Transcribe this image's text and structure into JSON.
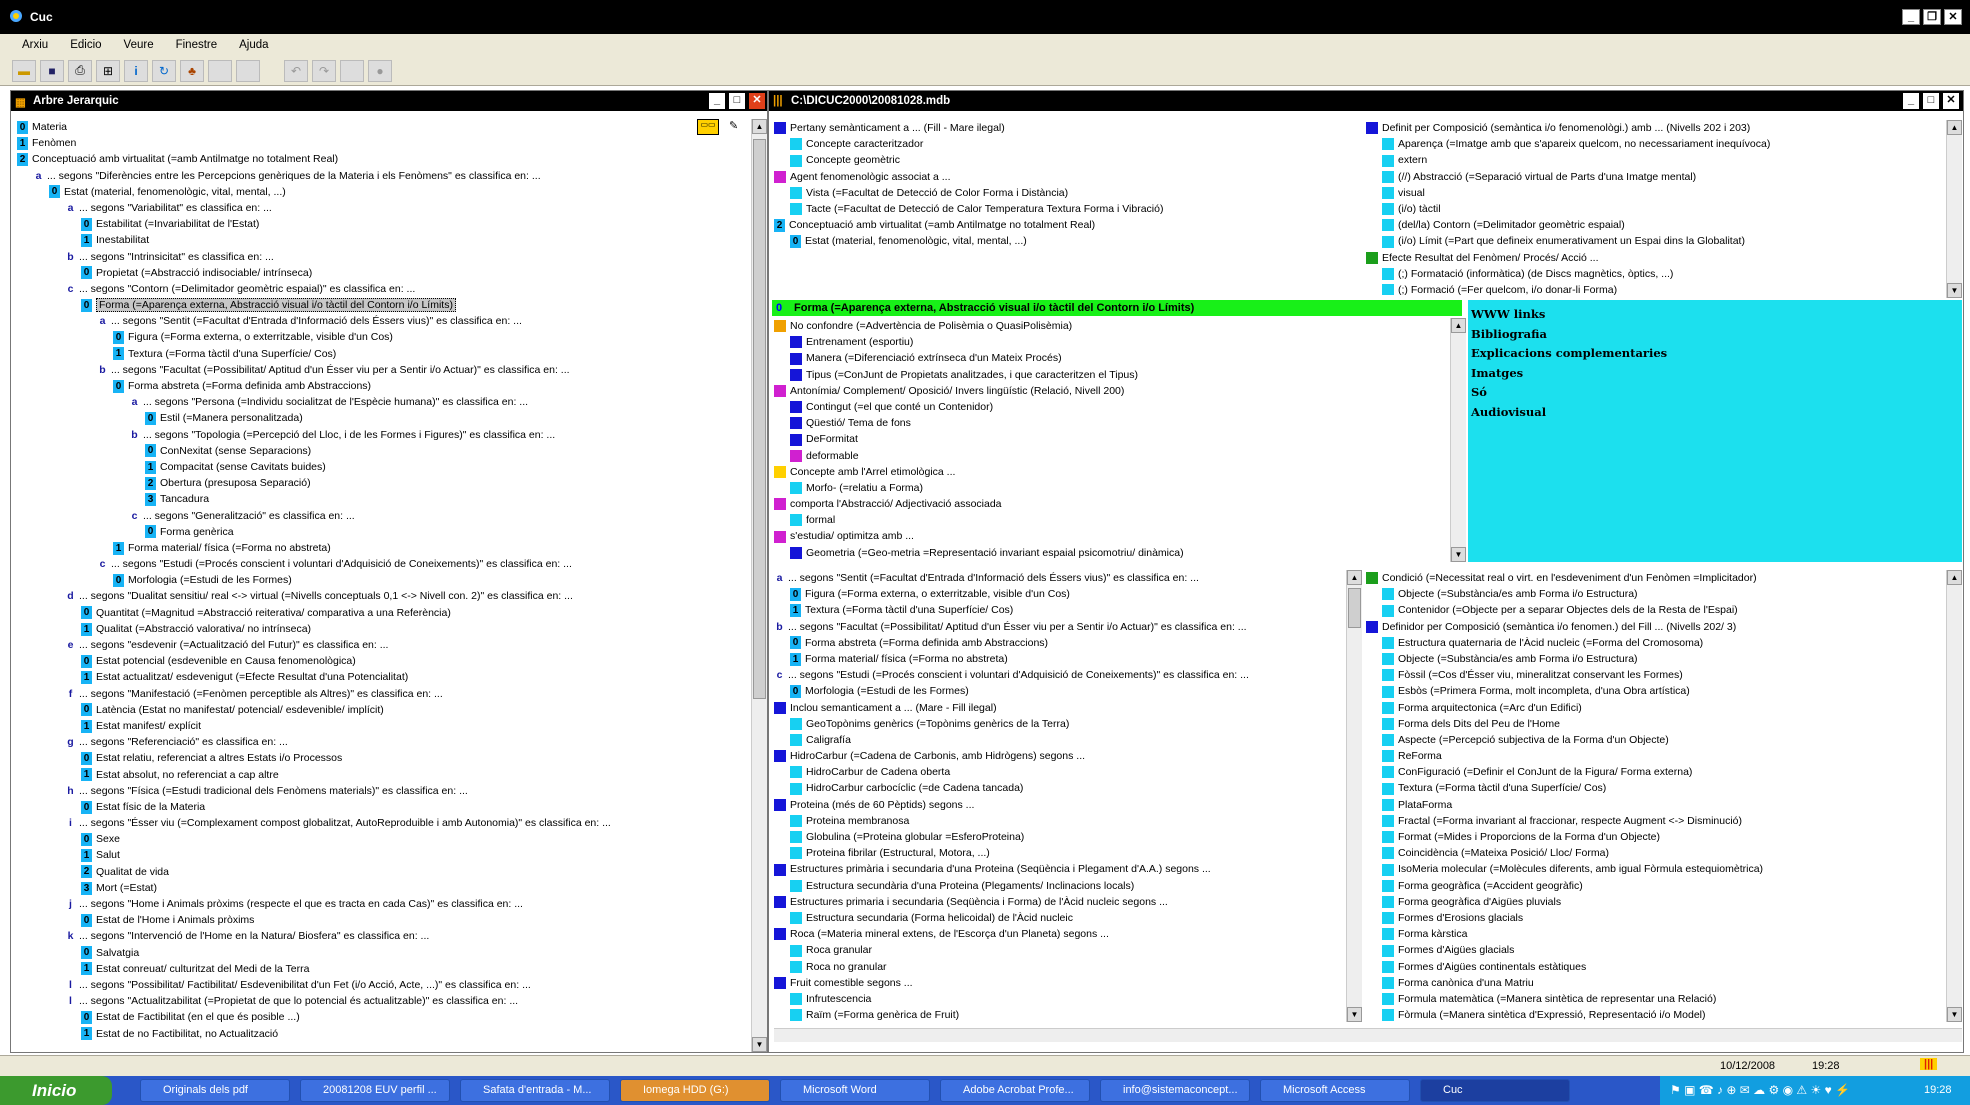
{
  "app": {
    "title": "Cuc",
    "menu": [
      "Arxiu",
      "Edicio",
      "Veure",
      "Finestre",
      "Ajuda"
    ]
  },
  "tree_panel": {
    "title": "Arbre Jerarquic",
    "rows": [
      {
        "i": 0,
        "t": "n",
        "m": "0",
        "x": "Materia"
      },
      {
        "i": 0,
        "t": "n",
        "m": "1",
        "x": "Fenòmen"
      },
      {
        "i": 0,
        "t": "n",
        "m": "2",
        "x": "Conceptuació amb virtualitat (=amb Antilmatge no totalment Real)"
      },
      {
        "i": 1,
        "t": "l",
        "m": "a",
        "x": "... segons \"Diferències entre les Percepcions genèriques de la Materia i els Fenòmens\" es classifica en: ..."
      },
      {
        "i": 2,
        "t": "n",
        "m": "0",
        "x": "Estat (material, fenomenològic, vital, mental, ...)"
      },
      {
        "i": 3,
        "t": "l",
        "m": "a",
        "x": "... segons \"Variabilitat\" es classifica en: ..."
      },
      {
        "i": 4,
        "t": "n",
        "m": "0",
        "x": "Estabilitat (=Invariabilitat de l'Estat)"
      },
      {
        "i": 4,
        "t": "n",
        "m": "1",
        "x": "Inestabilitat"
      },
      {
        "i": 3,
        "t": "l",
        "m": "b",
        "x": "... segons \"Intrinsicitat\" es classifica en: ..."
      },
      {
        "i": 4,
        "t": "n",
        "m": "0",
        "x": "Propietat (=Abstracció indisociable/ intrínseca)"
      },
      {
        "i": 3,
        "t": "l",
        "m": "c",
        "x": "... segons \"Contorn (=Delimitador geomètric espaial)\" es classifica en: ..."
      },
      {
        "i": 4,
        "t": "s",
        "m": "0",
        "x": "Forma (=Aparença externa, Abstracció visual i/o tàctil del Contorn i/o Límits)"
      },
      {
        "i": 5,
        "t": "l",
        "m": "a",
        "x": "... segons \"Sentit (=Facultat d'Entrada d'Informació dels Éssers vius)\" es classifica en: ..."
      },
      {
        "i": 6,
        "t": "n",
        "m": "0",
        "x": "Figura (=Forma externa, o exterritzable, visible d'un Cos)"
      },
      {
        "i": 6,
        "t": "n",
        "m": "1",
        "x": "Textura (=Forma tàctil d'una Superfície/ Cos)"
      },
      {
        "i": 5,
        "t": "l",
        "m": "b",
        "x": "... segons \"Facultat (=Possibilitat/ Aptitud d'un Ésser viu per a Sentir i/o Actuar)\" es classifica en: ..."
      },
      {
        "i": 6,
        "t": "n",
        "m": "0",
        "x": "Forma abstreta (=Forma definida amb Abstraccions)"
      },
      {
        "i": 7,
        "t": "l",
        "m": "a",
        "x": "... segons \"Persona (=Individu socialitzat de l'Espècie humana)\" es classifica en: ..."
      },
      {
        "i": 8,
        "t": "n",
        "m": "0",
        "x": "Estil (=Manera personalitzada)"
      },
      {
        "i": 7,
        "t": "l",
        "m": "b",
        "x": "... segons \"Topologia (=Percepció del Lloc, i de les Formes i Figures)\" es classifica en: ..."
      },
      {
        "i": 8,
        "t": "n",
        "m": "0",
        "x": "ConNexitat (sense Separacions)"
      },
      {
        "i": 8,
        "t": "n",
        "m": "1",
        "x": "Compacitat (sense Cavitats buides)"
      },
      {
        "i": 8,
        "t": "n",
        "m": "2",
        "x": "Obertura (presuposa Separació)"
      },
      {
        "i": 8,
        "t": "n",
        "m": "3",
        "x": "Tancadura"
      },
      {
        "i": 7,
        "t": "l",
        "m": "c",
        "x": "... segons \"Generalització\" es classifica en: ..."
      },
      {
        "i": 8,
        "t": "n",
        "m": "0",
        "x": "Forma genèrica"
      },
      {
        "i": 6,
        "t": "n",
        "m": "1",
        "x": "Forma material/ física (=Forma no abstreta)"
      },
      {
        "i": 5,
        "t": "l",
        "m": "c",
        "x": "... segons \"Estudi (=Procés conscient i voluntari d'Adquisició de Coneixements)\" es classifica en: ..."
      },
      {
        "i": 6,
        "t": "n",
        "m": "0",
        "x": "Morfologia (=Estudi de les Formes)"
      },
      {
        "i": 3,
        "t": "l",
        "m": "d",
        "x": "... segons \"Dualitat sensitiu/ real <-> virtual (=Nivells conceptuals 0,1 <-> Nivell con. 2)\" es classifica en: ..."
      },
      {
        "i": 4,
        "t": "n",
        "m": "0",
        "x": "Quantitat (=Magnitud =Abstracció reiterativa/ comparativa a una Referència)"
      },
      {
        "i": 4,
        "t": "n",
        "m": "1",
        "x": "Qualitat (=Abstracció valorativa/ no intrínseca)"
      },
      {
        "i": 3,
        "t": "l",
        "m": "e",
        "x": "... segons \"esdevenir (=Actualització del Futur)\" es classifica en: ..."
      },
      {
        "i": 4,
        "t": "n",
        "m": "0",
        "x": "Estat potencial (esdevenible en Causa fenomenològica)"
      },
      {
        "i": 4,
        "t": "n",
        "m": "1",
        "x": "Estat actualitzat/ esdevenigut (=Efecte Resultat d'una Potencialitat)"
      },
      {
        "i": 3,
        "t": "l",
        "m": "f",
        "x": "... segons \"Manifestació (=Fenòmen perceptible als Altres)\" es classifica en: ..."
      },
      {
        "i": 4,
        "t": "n",
        "m": "0",
        "x": "Latència (Estat no manifestat/ potencial/ esdevenible/ implícit)"
      },
      {
        "i": 4,
        "t": "n",
        "m": "1",
        "x": "Estat manifest/ explícit"
      },
      {
        "i": 3,
        "t": "l",
        "m": "g",
        "x": "... segons \"Referenciació\" es classifica en: ..."
      },
      {
        "i": 4,
        "t": "n",
        "m": "0",
        "x": "Estat relatiu, referenciat a altres Estats i/o Processos"
      },
      {
        "i": 4,
        "t": "n",
        "m": "1",
        "x": "Estat absolut, no referenciat a cap altre"
      },
      {
        "i": 3,
        "t": "l",
        "m": "h",
        "x": "... segons \"Física (=Estudi tradicional dels Fenòmens materials)\" es classifica en: ..."
      },
      {
        "i": 4,
        "t": "n",
        "m": "0",
        "x": "Estat físic de la Materia"
      },
      {
        "i": 3,
        "t": "l",
        "m": "i",
        "x": "... segons \"Ésser viu (=Complexament compost globalitzat, AutoReproduible i amb Autonomia)\" es classifica en: ..."
      },
      {
        "i": 4,
        "t": "n",
        "m": "0",
        "x": "Sexe"
      },
      {
        "i": 4,
        "t": "n",
        "m": "1",
        "x": "Salut"
      },
      {
        "i": 4,
        "t": "n",
        "m": "2",
        "x": "Qualitat de vida"
      },
      {
        "i": 4,
        "t": "n",
        "m": "3",
        "x": "Mort (=Estat)"
      },
      {
        "i": 3,
        "t": "l",
        "m": "j",
        "x": "... segons \"Home i Animals pròxims (respecte el que es tracta en cada Cas)\" es classifica en: ..."
      },
      {
        "i": 4,
        "t": "n",
        "m": "0",
        "x": "Estat de l'Home i Animals pròxims"
      },
      {
        "i": 3,
        "t": "l",
        "m": "k",
        "x": "... segons \"Intervenció de l'Home en la Natura/ Biosfera\" es classifica en: ..."
      },
      {
        "i": 4,
        "t": "n",
        "m": "0",
        "x": "Salvatgia"
      },
      {
        "i": 4,
        "t": "n",
        "m": "1",
        "x": "Estat conreuat/ culturitzat del Medi de la Terra"
      },
      {
        "i": 3,
        "t": "l",
        "m": "l",
        "x": "... segons \"Possibilitat/ Factibilitat/ Esdevenibilitat d'un Fet (i/o Acció, Acte, ...)\" es classifica en: ..."
      },
      {
        "i": 3,
        "t": "l",
        "m": "l",
        "x": "... segons \"Actualitzabilitat (=Propietat de que lo potencial és actualitzable)\" es classifica en: ..."
      },
      {
        "i": 4,
        "t": "n",
        "m": "0",
        "x": "Estat de Factibilitat (en el que és posible ...)"
      },
      {
        "i": 4,
        "t": "n",
        "m": "1",
        "x": "Estat de no Factibilitat, no Actualització"
      }
    ]
  },
  "db_panel": {
    "title": "C:\\DICUC2000\\20081028.mdb",
    "top_left": [
      {
        "c": "blue",
        "i": 0,
        "x": "Pertany semànticament a ... (Fill - Mare ilegal)"
      },
      {
        "c": "cyan",
        "i": 1,
        "x": "Concepte caracteritzador"
      },
      {
        "c": "cyan",
        "i": 1,
        "x": "Concepte geomètric"
      },
      {
        "c": "mag",
        "i": 0,
        "x": "Agent fenomenològic associat a ..."
      },
      {
        "c": "cyan",
        "i": 1,
        "x": "Vista (=Facultat de Detecció de Color Forma i Distància)"
      },
      {
        "c": "cyan",
        "i": 1,
        "x": "Tacte (=Facultat de Detecció de Calor Temperatura Textura Forma i Vibració)"
      },
      {
        "c": "num",
        "m": "2",
        "i": 0,
        "x": "Conceptuació amb virtualitat (=amb Antilmatge no totalment Real)"
      },
      {
        "c": "num",
        "m": "0",
        "i": 1,
        "x": "Estat (material, fenomenològic, vital, mental, ...)"
      }
    ],
    "top_right": [
      {
        "c": "blue",
        "i": 0,
        "x": "Definit per Composició (semàntica i/o fenomenològi.) amb ... (Nivells 202 i 203)"
      },
      {
        "c": "cyan",
        "i": 1,
        "x": "Aparença (=Imatge amb que s'apareix quelcom, no necessariament inequívoca)"
      },
      {
        "c": "cyan",
        "i": 1,
        "x": "extern"
      },
      {
        "c": "cyan",
        "i": 1,
        "x": "(//) Abstracció (=Separació virtual de Parts d'una Imatge mental)"
      },
      {
        "c": "cyan",
        "i": 1,
        "x": "visual"
      },
      {
        "c": "cyan",
        "i": 1,
        "x": "(i/o) tàctil"
      },
      {
        "c": "cyan",
        "i": 1,
        "x": "(del/la) Contorn (=Delimitador geomètric espaial)"
      },
      {
        "c": "cyan",
        "i": 1,
        "x": "(i/o) Límit (=Part que defineix enumerativament un Espai dins la Globalitat)"
      },
      {
        "c": "grn",
        "i": 0,
        "x": "Efecte Resultat del Fenòmen/ Procés/ Acció ..."
      },
      {
        "c": "cyan",
        "i": 1,
        "x": "(;) Formatació (informàtica) (de Discs magnètics, òptics, ...)"
      },
      {
        "c": "cyan",
        "i": 1,
        "x": "(;) Formació (=Fer quelcom, i/o donar-li Forma)"
      }
    ],
    "selected": "Forma (=Aparença externa, Abstracció visual i/o tàctil del Contorn i/o Límits)",
    "mid_left": [
      {
        "c": "orng",
        "i": 0,
        "x": "No confondre (=Advertència de Polisèmia o QuasiPolisèmia)"
      },
      {
        "c": "blue",
        "i": 1,
        "x": "Entrenament (esportiu)"
      },
      {
        "c": "blue",
        "i": 1,
        "x": "Manera (=Diferenciació extrínseca d'un Mateix Procés)"
      },
      {
        "c": "blue",
        "i": 1,
        "x": "Tipus (=ConJunt de Propietats analitzades, i que caracteritzen el Tipus)"
      },
      {
        "c": "mag",
        "i": 0,
        "x": "Antonímia/ Complement/ Oposició/ Invers lingüístic (Relació, Nivell 200)"
      },
      {
        "c": "blue",
        "i": 1,
        "x": "Contingut (=el que conté un Contenidor)"
      },
      {
        "c": "blue",
        "i": 1,
        "x": "Qüestió/ Tema de fons"
      },
      {
        "c": "blue",
        "i": 1,
        "x": "DeFormitat"
      },
      {
        "c": "mag",
        "i": 1,
        "x": "deformable"
      },
      {
        "c": "yel",
        "i": 0,
        "x": "Concepte amb l'Arrel etimològica ..."
      },
      {
        "c": "cyan",
        "i": 1,
        "x": "Morfo- (=relatiu a Forma)"
      },
      {
        "c": "mag",
        "i": 0,
        "x": "comporta l'Abstracció/ Adjectivació associada"
      },
      {
        "c": "cyan",
        "i": 1,
        "x": "formal"
      },
      {
        "c": "mag",
        "i": 0,
        "x": "s'estudia/ optimitza amb ..."
      },
      {
        "c": "blue",
        "i": 1,
        "x": "Geometria (=Geo-metria =Representació invariant espaial psicomotriu/ dinàmica)"
      }
    ],
    "links": [
      "WWW links",
      "Bibliografia",
      "Explicacions complementaries",
      "Imatges",
      "Só",
      "Audiovisual"
    ],
    "bot_left": [
      {
        "c": "let",
        "m": "a",
        "i": 0,
        "x": "... segons \"Sentit (=Facultat d'Entrada d'Informació dels Éssers vius)\" es classifica en: ..."
      },
      {
        "c": "num",
        "m": "0",
        "i": 1,
        "x": "Figura (=Forma externa, o exterritzable, visible d'un Cos)"
      },
      {
        "c": "num",
        "m": "1",
        "i": 1,
        "x": "Textura (=Forma tàctil d'una Superfície/ Cos)"
      },
      {
        "c": "let",
        "m": "b",
        "i": 0,
        "x": "... segons \"Facultat (=Possibilitat/ Aptitud d'un Ésser viu per a Sentir i/o Actuar)\" es classifica en: ..."
      },
      {
        "c": "num",
        "m": "0",
        "i": 1,
        "x": "Forma abstreta (=Forma definida amb Abstraccions)"
      },
      {
        "c": "num",
        "m": "1",
        "i": 1,
        "x": "Forma material/ física (=Forma no abstreta)"
      },
      {
        "c": "let",
        "m": "c",
        "i": 0,
        "x": "... segons \"Estudi (=Procés conscient i voluntari d'Adquisició de Coneixements)\" es classifica en: ..."
      },
      {
        "c": "num",
        "m": "0",
        "i": 1,
        "x": "Morfologia (=Estudi de les Formes)"
      },
      {
        "c": "blue",
        "i": 0,
        "x": "Inclou semanticament a ... (Mare - Fill ilegal)"
      },
      {
        "c": "cyan",
        "i": 1,
        "x": "GeoTopònims genèrics (=Topònims genèrics de la Terra)"
      },
      {
        "c": "cyan",
        "i": 1,
        "x": "Caligrafía"
      },
      {
        "c": "blue",
        "i": 0,
        "x": "HidroCarbur (=Cadena de Carbonis, amb Hidrògens) segons ..."
      },
      {
        "c": "cyan",
        "i": 1,
        "x": "HidroCarbur de Cadena oberta"
      },
      {
        "c": "cyan",
        "i": 1,
        "x": "HidroCarbur carbocíclic (=de Cadena tancada)"
      },
      {
        "c": "blue",
        "i": 0,
        "x": "Proteina (més de 60 Pèptids) segons ..."
      },
      {
        "c": "cyan",
        "i": 1,
        "x": "Proteina membranosa"
      },
      {
        "c": "cyan",
        "i": 1,
        "x": "Globulina (=Proteina globular =EsferoProteina)"
      },
      {
        "c": "cyan",
        "i": 1,
        "x": "Proteina fibrilar (Estructural, Motora, ...)"
      },
      {
        "c": "blue",
        "i": 0,
        "x": "Estructures primària i secundaria d'una Proteina (Seqüència i Plegament d'A.A.) segons ..."
      },
      {
        "c": "cyan",
        "i": 1,
        "x": "Estructura secundària d'una Proteina (Plegaments/ Inclinacions locals)"
      },
      {
        "c": "blue",
        "i": 0,
        "x": "Estructures primaria i secundaria (Seqüència i Forma) de l'Àcid nucleic segons ..."
      },
      {
        "c": "cyan",
        "i": 1,
        "x": "Estructura secundaria (Forma helicoidal) de l'Àcid nucleic"
      },
      {
        "c": "blue",
        "i": 0,
        "x": "Roca (=Materia mineral extens, de l'Escorça d'un Planeta) segons ..."
      },
      {
        "c": "cyan",
        "i": 1,
        "x": "Roca granular"
      },
      {
        "c": "cyan",
        "i": 1,
        "x": "Roca no granular"
      },
      {
        "c": "blue",
        "i": 0,
        "x": "Fruit comestible segons ..."
      },
      {
        "c": "cyan",
        "i": 1,
        "x": "Infrutescencia"
      },
      {
        "c": "cyan",
        "i": 1,
        "x": "Raïm (=Forma genèrica de Fruit)"
      }
    ],
    "bot_right": [
      {
        "c": "grn",
        "i": 0,
        "x": "Condició (=Necessitat real o virt. en l'esdeveniment d'un Fenòmen =Implicitador)"
      },
      {
        "c": "cyan",
        "i": 1,
        "x": "Objecte (=Substància/es amb Forma i/o Estructura)"
      },
      {
        "c": "cyan",
        "i": 1,
        "x": "Contenidor (=Objecte per a separar Objectes dels de la Resta de l'Espai)"
      },
      {
        "c": "blue",
        "i": 0,
        "x": "Definidor per Composició (semàntica i/o fenomen.) del Fill ... (Nivells 202/ 3)"
      },
      {
        "c": "cyan",
        "i": 1,
        "x": "Estructura quaternaria de l'Àcid nucleic (=Forma del Cromosoma)"
      },
      {
        "c": "cyan",
        "i": 1,
        "x": "Objecte (=Substància/es amb Forma i/o Estructura)"
      },
      {
        "c": "cyan",
        "i": 1,
        "x": "Fòssil (=Cos d'Ésser viu, mineralitzat conservant les Formes)"
      },
      {
        "c": "cyan",
        "i": 1,
        "x": "Esbòs (=Primera Forma, molt incompleta, d'una Obra artística)"
      },
      {
        "c": "cyan",
        "i": 1,
        "x": "Forma arquitectonica (=Arc d'un Edifici)"
      },
      {
        "c": "cyan",
        "i": 1,
        "x": "Forma dels Dits del Peu de l'Home"
      },
      {
        "c": "cyan",
        "i": 1,
        "x": "Aspecte (=Percepció subjectiva de la Forma d'un Objecte)"
      },
      {
        "c": "cyan",
        "i": 1,
        "x": "ReForma"
      },
      {
        "c": "cyan",
        "i": 1,
        "x": "ConFiguració (=Definir el ConJunt de la Figura/ Forma externa)"
      },
      {
        "c": "cyan",
        "i": 1,
        "x": "Textura (=Forma tàctil d'una Superfície/ Cos)"
      },
      {
        "c": "cyan",
        "i": 1,
        "x": "PlataForma"
      },
      {
        "c": "cyan",
        "i": 1,
        "x": "Fractal (=Forma invariant al fraccionar, respecte Augment <-> Disminució)"
      },
      {
        "c": "cyan",
        "i": 1,
        "x": "Format (=Mides i Proporcions de la Forma d'un Objecte)"
      },
      {
        "c": "cyan",
        "i": 1,
        "x": "Coincidència (=Mateixa Posició/ Lloc/ Forma)"
      },
      {
        "c": "cyan",
        "i": 1,
        "x": "IsoMeria molecular (=Molècules diferents, amb igual Fòrmula estequiomètrica)"
      },
      {
        "c": "cyan",
        "i": 1,
        "x": "Forma geogràfica (=Accident geogràfic)"
      },
      {
        "c": "cyan",
        "i": 1,
        "x": "Forma geogràfica d'Aigües pluvials"
      },
      {
        "c": "cyan",
        "i": 1,
        "x": "Formes d'Erosions glacials"
      },
      {
        "c": "cyan",
        "i": 1,
        "x": "Forma kàrstica"
      },
      {
        "c": "cyan",
        "i": 1,
        "x": "Formes d'Aigües glacials"
      },
      {
        "c": "cyan",
        "i": 1,
        "x": "Formes d'Aigües continentals estàtiques"
      },
      {
        "c": "cyan",
        "i": 1,
        "x": "Forma canònica d'una Matriu"
      },
      {
        "c": "cyan",
        "i": 1,
        "x": "Formula matemàtica (=Manera sintètica de representar una Relació)"
      },
      {
        "c": "cyan",
        "i": 1,
        "x": "Fòrmula (=Manera sintètica d'Expressió, Representació i/o Model)"
      }
    ]
  },
  "status": {
    "date": "10/12/2008",
    "time": "19:28"
  },
  "taskbar": {
    "start": "Inicio",
    "tasks": [
      "Originals dels pdf",
      "20081208 EUV perfil ...",
      "Safata d'entrada - M...",
      "Iomega HDD (G:)",
      "Microsoft Word",
      "Adobe Acrobat Profe...",
      "info@sistemaconcept...",
      "Microsoft Access",
      "Cuc"
    ],
    "clock": "19:28"
  }
}
